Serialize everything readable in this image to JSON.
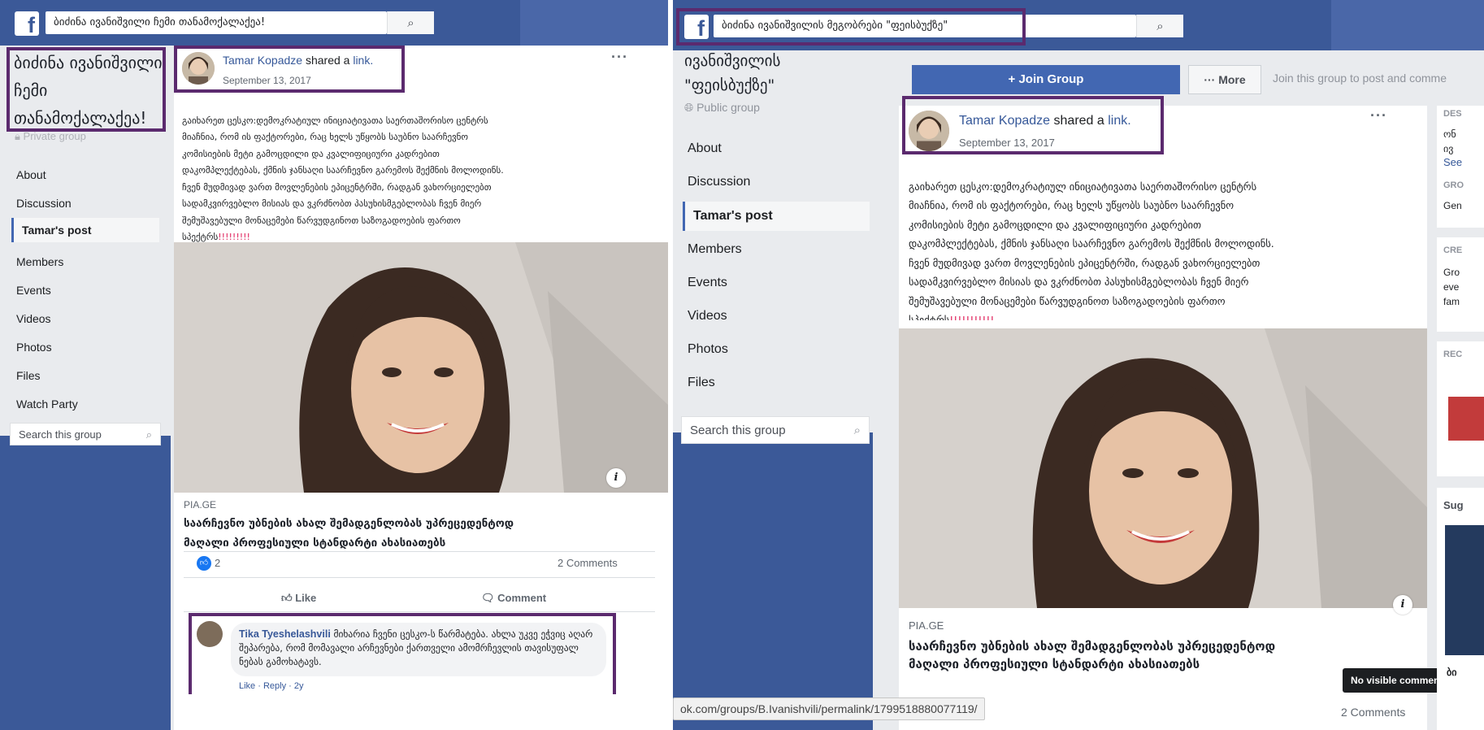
{
  "left_panel": {
    "search_text": "ბიძინა ივანიშვილი ჩემი თანამოქალაქეა!",
    "group_title": "ბიძინა ივანიშვილი\nჩემი\nთანამოქალაქეა!",
    "group_privacy": "Private group",
    "nav": [
      "About",
      "Discussion",
      "Tamar's post",
      "Members",
      "Events",
      "Videos",
      "Photos",
      "Files",
      "Watch Party"
    ],
    "group_search_placeholder": "Search this group",
    "post": {
      "author": "Tamar Kopadze",
      "shared": "shared a",
      "link": "link.",
      "date": "September 13, 2017",
      "body": "გაიხარეთ ცესკო:დემოკრატიულ ინიციატივათა საერთაშორისო ცენტრს\nმიაჩნია, რომ ის ფაქტორები, რაც ხელს უწყობს საუბნო საარჩევნო\nკომისიების მეტი გამოცდილი და კვალიფიციური კადრებით\nდაკომპლექტებას, ქმნის ჯანსაღი საარჩევნო გარემოს შექმნის მოლოდინს.\nჩვენ მუდმივად ვართ მოვლენების ეპიცენტრში, რადგან ვახორციელებთ\nსადამკვირვებლო მისიას და ვკრძნობთ პასუხისმგებლობას ჩვენ მიერ\nშემუშავებული მონაცემები წარვუდგინოთ საზოგადოების ფართო\nსპექტრს",
      "exclaim": "!!!!!!!!!",
      "domain": "PIA.GE",
      "headline": "საარჩევნო უბნების ახალ შემადგენლობას უპრეცედენტოდ\nმაღალი პროფესიული სტანდარტი ახასიათებს",
      "likes": "2",
      "comments": "2 Comments",
      "like_label": "Like",
      "comment_label": "Comment"
    },
    "comment": {
      "author": "Tika Tyeshelashvili",
      "text": "მიხარია ჩვენი ცესკო-ს წარმატება. ახლა უკვე ეჭვიც აღარ შეპარება, რომ მომავალი არჩევნები ქართველი ამომრჩევლის თავისუფალ ნებას გამოხატავს.",
      "actions": "Like · Reply · 2y"
    }
  },
  "right_panel": {
    "search_text": "ბიძინა ივანიშვილის მეგობრები \"ფეისბუქზე\"",
    "group_title": "ივანიშვილის\n\"ფეისბუქზე\"",
    "group_privacy": "Public group",
    "join_label": "+ Join Group",
    "more_label": "··· More",
    "join_hint": "Join this group to post and comme",
    "nav": [
      "About",
      "Discussion",
      "Tamar's post",
      "Members",
      "Events",
      "Videos",
      "Photos",
      "Files"
    ],
    "group_search_placeholder": "Search this group",
    "post": {
      "author": "Tamar Kopadze",
      "shared": "shared a",
      "link": "link.",
      "date": "September 13, 2017",
      "body": "გაიხარეთ ცესკო:დემოკრატიულ ინიციატივათა საერთაშორისო ცენტრს\nმიაჩნია, რომ ის ფაქტორები, რაც ხელს უწყობს საუბნო საარჩევნო\nკომისიების მეტი გამოცდილი და კვალიფიციური კადრებით\nდაკომპლექტებას, ქმნის ჯანსაღი საარჩევნო გარემოს შექმნის მოლოდინს.\nჩვენ მუდმივად ვართ მოვლენების ეპიცენტრში, რადგან ვახორციელებთ\nსადამკვირვებლო მისიას და ვკრძნობთ პასუხისმგებლობას ჩვენ მიერ\nშემუშავებული მონაცემები წარვუდგინოთ საზოგადოების ფართო\nსპექტრს",
      "exclaim": "!!!!!!!!!!!",
      "domain": "PIA.GE",
      "headline": "საარჩევნო უბნების ახალ შემადგენლობას უპრეცედენტოდ\nმაღალი პროფესიული სტანდარტი ახასიათებს",
      "comments": "2 Comments"
    },
    "tooltip": "No visible comments",
    "url": "ok.com/groups/B.Ivanishvili/permalink/1799518880077119/",
    "rightcol": {
      "c1_head": "DES",
      "c1_lines": [
        "ონ",
        "ივ",
        "See"
      ],
      "c1_group_head": "GRO",
      "c1_group_line": "Gen",
      "c2_head": "CRE",
      "c2_lines": [
        "Gro",
        "eve",
        "fam"
      ],
      "c3_head": "REC",
      "c4_head": "Sug",
      "c4_line": "ბი"
    }
  }
}
